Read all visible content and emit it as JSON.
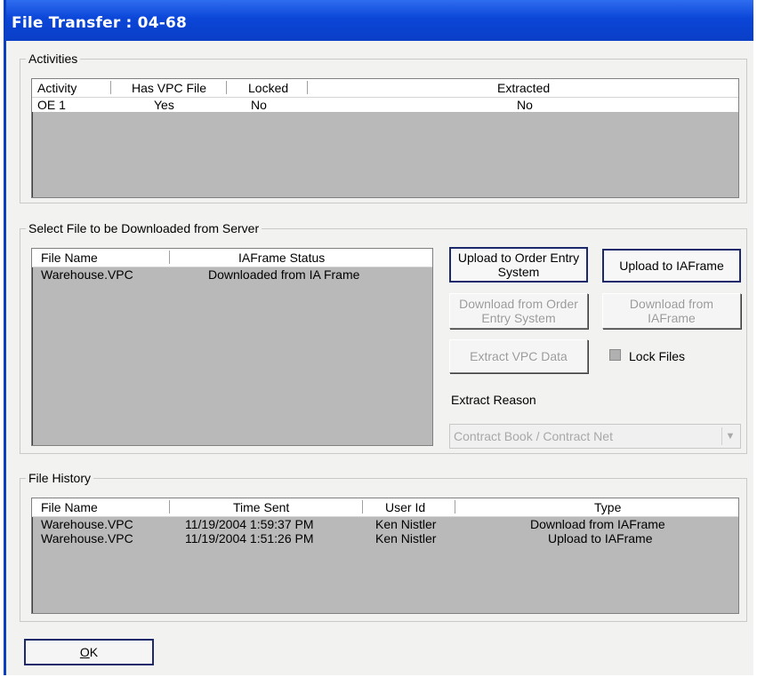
{
  "window": {
    "title": "File Transfer : 04-68"
  },
  "activities": {
    "legend": "Activities",
    "columns": [
      "Activity",
      "Has VPC File",
      "Locked",
      "Extracted"
    ],
    "rows": [
      {
        "activity": "OE 1",
        "has_vpc": "Yes",
        "locked": "No",
        "extracted": "No"
      }
    ]
  },
  "select_file": {
    "legend": "Select File to be Downloaded from Server",
    "columns": [
      "File Name",
      "IAFrame Status"
    ],
    "rows": [
      {
        "file": "Warehouse.VPC",
        "status": "Downloaded from IA Frame"
      }
    ],
    "buttons": {
      "upload_oe_line1": "Upload to Order Entry",
      "upload_oe_line2": "System",
      "upload_iaframe": "Upload to IAFrame",
      "download_oe_line1": "Download from Order",
      "download_oe_line2": "Entry System",
      "download_iaframe_line1": "Download from",
      "download_iaframe_line2": "IAFrame",
      "extract_vpc": "Extract VPC Data"
    },
    "lock_files_label": "Lock Files",
    "lock_files_checked": false,
    "extract_reason_label": "Extract Reason",
    "extract_reason_value": "Contract Book / Contract Net"
  },
  "file_history": {
    "legend": "File History",
    "columns": [
      "File Name",
      "Time Sent",
      "User Id",
      "Type"
    ],
    "rows": [
      {
        "file": "Warehouse.VPC",
        "time": "11/19/2004 1:59:37 PM",
        "user": "Ken Nistler",
        "type": "Download from IAFrame"
      },
      {
        "file": "Warehouse.VPC",
        "time": "11/19/2004 1:51:26 PM",
        "user": "Ken Nistler",
        "type": "Upload to IAFrame"
      }
    ]
  },
  "ok_button": {
    "mnemonic": "O",
    "rest": "K"
  },
  "colors": {
    "titlebar": "#0b46d8",
    "list_bg": "#b9b9b9",
    "dialog_bg": "#f2f2f0"
  }
}
